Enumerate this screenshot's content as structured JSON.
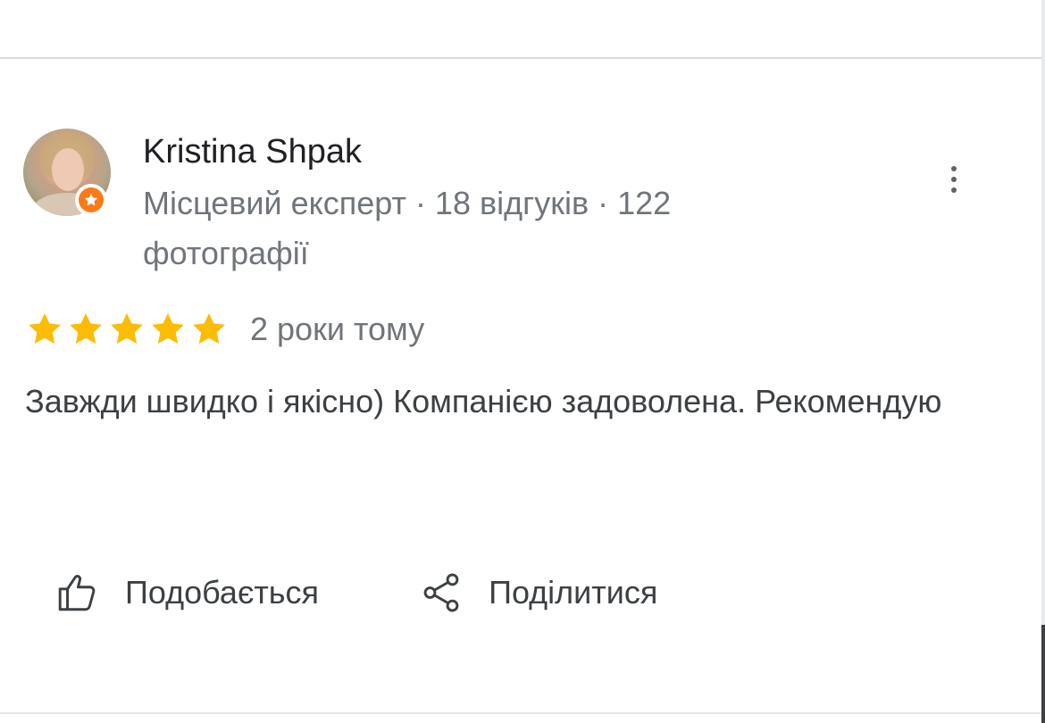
{
  "review": {
    "reviewer": {
      "name": "Kristina Shpak",
      "meta": "Місцевий експерт · 18 відгуків · 122 фотографії",
      "badge_icon": "local-guide-star-icon",
      "badge_color": "#fa7b17"
    },
    "rating": {
      "stars": 5,
      "max_stars": 5,
      "star_color": "#fbbc04"
    },
    "date": "2 роки тому",
    "text": "Завжди швидко і якісно) Компанією задоволена. Рекомендую",
    "more_menu_icon": "more-vert-icon"
  },
  "actions": {
    "like_label": "Подобається",
    "like_icon": "thumb-up-icon",
    "share_label": "Поділитися",
    "share_icon": "share-icon"
  }
}
